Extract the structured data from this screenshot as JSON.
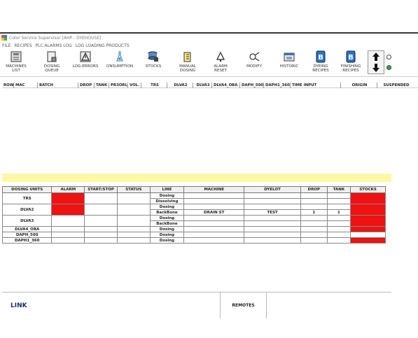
{
  "window": {
    "title": "Color Service Supervisor [AHP - DYEHOUSE]"
  },
  "menu": [
    "FILE",
    "RECIPES",
    "PLC ALARMS LOG",
    "LOG LOADING PRODUCTS"
  ],
  "toolbar": {
    "machines_list": "MACHINES\nLIST",
    "dosing_queue": "DOSING\nQUEUE",
    "log_errors": "LOG-ERRORS",
    "consumption": "ONSUMPTION",
    "stocks": "STOCKS",
    "manual_dosing": "MANUAL\nDOSING",
    "alarm_reset": "ALARM\nRESET",
    "modify": "MODIFY",
    "historic": "HISTORIC",
    "dyeing_recipes": "DYEING\nRECIPES",
    "finishing_recipes": "FINISHING\nRECIPES"
  },
  "queue_headers": [
    "ROW",
    "MAC",
    "BATCH",
    "DROP",
    "TANK",
    "PR3ORL",
    "VOL.",
    "TRS",
    "DLVA2",
    "DLVA3",
    "DLVA4_OBA",
    "DAPH_500",
    "DAPH1_360",
    "TIME INPUT",
    "ORIGIN",
    "SUSPENDED"
  ],
  "units_headers": [
    "DOSING UNITS",
    "ALARM",
    "START/STOP",
    "STATUS",
    "LINE",
    "MACHINE",
    "DYELOT",
    "DROP",
    "TANK",
    "STOCKS"
  ],
  "units": {
    "trs": "TRS",
    "dlva2": "DLVA2",
    "dlva3": "DLVA3",
    "dlva4": "DLVA4_OBA",
    "daph500": "DAPH_500",
    "daph1": "DAPH1_360",
    "lines": [
      "Dosing",
      "Dissolving",
      "Dosing",
      "BackBone",
      "Dosing",
      "BackBone",
      "Dosing",
      "Dosing",
      "Dosing"
    ],
    "machine": "DRAIN ST",
    "dyelot": "TEST",
    "drop": "1",
    "tank": "1"
  },
  "bottom": {
    "link": "LINK",
    "remotes": "REMOTES"
  },
  "colors": {
    "alarm_red": "#ee1212",
    "yellow_bar": "#fdf8a6"
  }
}
